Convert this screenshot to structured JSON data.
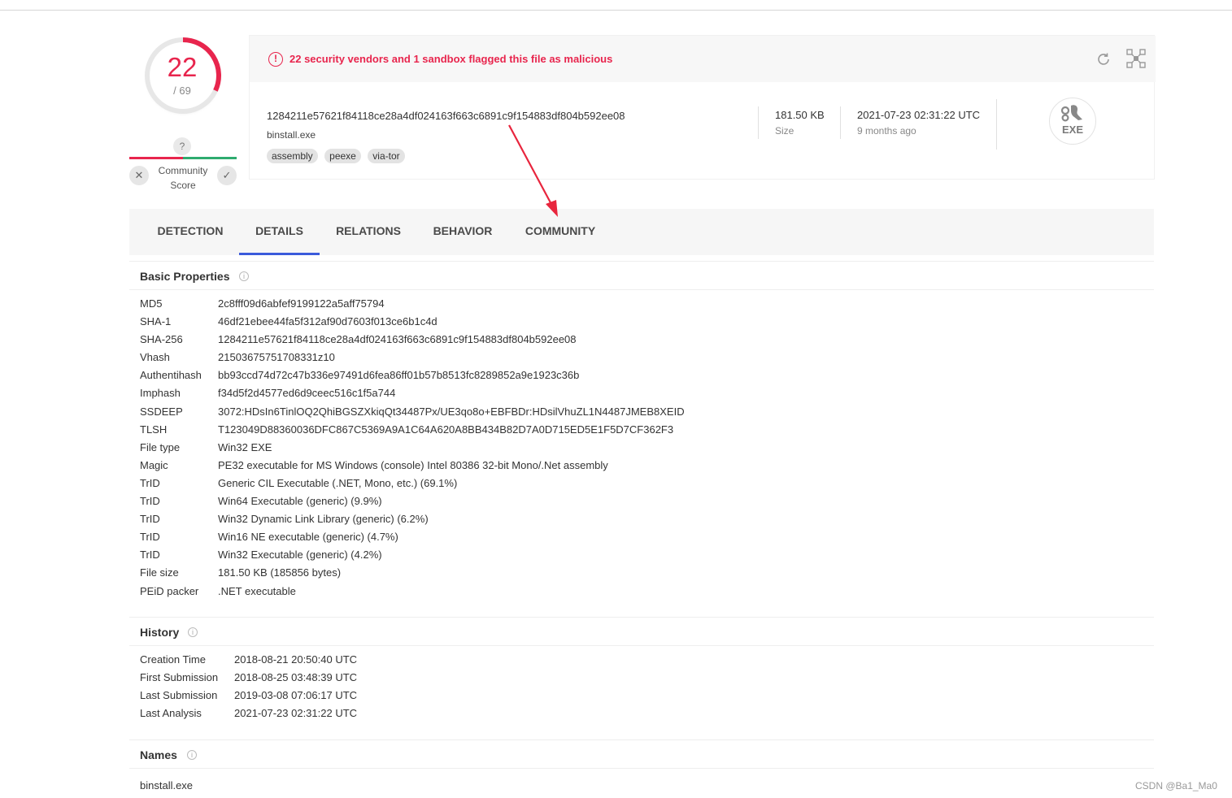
{
  "score": {
    "detected": "22",
    "total": "/ 69"
  },
  "community": {
    "question": "?",
    "label_line1": "Community",
    "label_line2": "Score",
    "dislike": "✕",
    "like": "✓"
  },
  "alert": {
    "icon": "!",
    "text": "22 security vendors and 1 sandbox flagged this file as malicious"
  },
  "file": {
    "hash": "1284211e57621f84118ce28a4df024163f663c6891c9f154883df804b592ee08",
    "name": "binstall.exe",
    "tags": [
      "assembly",
      "peexe",
      "via-tor"
    ],
    "size_value": "181.50 KB",
    "size_label": "Size",
    "date_value": "2021-07-23 02:31:22 UTC",
    "date_label": "9 months ago",
    "type_badge": "EXE"
  },
  "tabs": [
    "DETECTION",
    "DETAILS",
    "RELATIONS",
    "BEHAVIOR",
    "COMMUNITY"
  ],
  "active_tab": "DETAILS",
  "basic_properties": {
    "title": "Basic Properties",
    "rows": [
      [
        "MD5",
        "2c8fff09d6abfef9199122a5aff75794"
      ],
      [
        "SHA-1",
        "46df21ebee44fa5f312af90d7603f013ce6b1c4d"
      ],
      [
        "SHA-256",
        "1284211e57621f84118ce28a4df024163f663c6891c9f154883df804b592ee08"
      ],
      [
        "Vhash",
        "21503675751708331z10"
      ],
      [
        "Authentihash",
        "bb93ccd74d72c47b336e97491d6fea86ff01b57b8513fc8289852a9e1923c36b"
      ],
      [
        "Imphash",
        "f34d5f2d4577ed6d9ceec516c1f5a744"
      ],
      [
        "SSDEEP",
        "3072:HDsIn6TinlOQ2QhiBGSZXkiqQt34487Px/UE3qo8o+EBFBDr:HDsilVhuZL1N4487JMEB8XEID"
      ],
      [
        "TLSH",
        "T123049D88360036DFC867C5369A9A1C64A620A8BB434B82D7A0D715ED5E1F5D7CF362F3"
      ],
      [
        "File type",
        "Win32 EXE"
      ],
      [
        "Magic",
        "PE32 executable for MS Windows (console) Intel 80386 32-bit Mono/.Net assembly"
      ],
      [
        "TrID",
        "Generic CIL Executable (.NET, Mono, etc.) (69.1%)"
      ],
      [
        "TrID",
        "Win64 Executable (generic) (9.9%)"
      ],
      [
        "TrID",
        "Win32 Dynamic Link Library (generic) (6.2%)"
      ],
      [
        "TrID",
        "Win16 NE executable (generic) (4.7%)"
      ],
      [
        "TrID",
        "Win32 Executable (generic) (4.2%)"
      ],
      [
        "File size",
        "181.50 KB (185856 bytes)"
      ],
      [
        "PEiD packer",
        ".NET executable"
      ]
    ]
  },
  "history": {
    "title": "History",
    "rows": [
      [
        "Creation Time",
        "2018-08-21 20:50:40 UTC"
      ],
      [
        "First Submission",
        "2018-08-25 03:48:39 UTC"
      ],
      [
        "Last Submission",
        "2019-03-08 07:06:17 UTC"
      ],
      [
        "Last Analysis",
        "2021-07-23 02:31:22 UTC"
      ]
    ]
  },
  "names": {
    "title": "Names",
    "rows": [
      "binstall.exe"
    ]
  },
  "watermark": "CSDN @Ba1_Ma0",
  "colors": {
    "malicious": "#e8254d",
    "accent": "#3b5bdb",
    "harmless": "#2eab6f",
    "annotation": "#e8253d"
  }
}
